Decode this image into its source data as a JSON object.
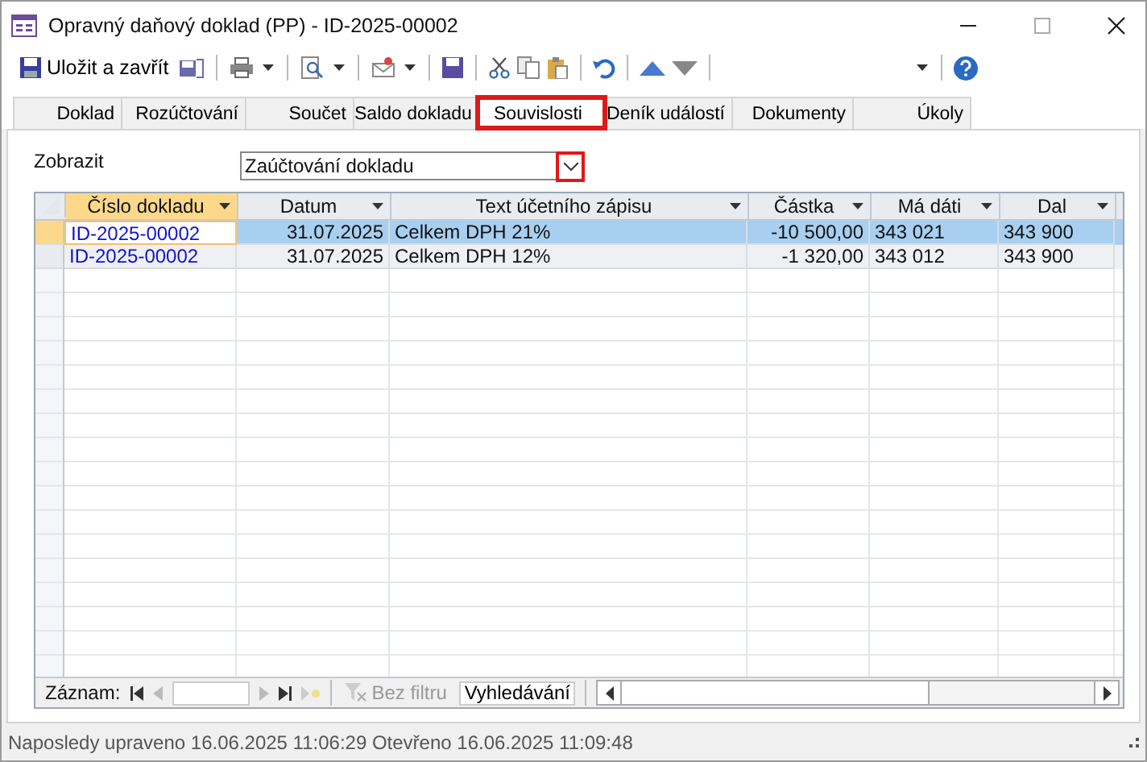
{
  "window": {
    "title": "Opravný daňový doklad (PP) - ID-2025-00002"
  },
  "toolbar": {
    "save_close": "Uložit a zavřít"
  },
  "tabs": [
    {
      "label": "Doklad",
      "selected": false,
      "highlighted": false
    },
    {
      "label": "Rozúčtování",
      "selected": false,
      "highlighted": false
    },
    {
      "label": "Součet",
      "selected": false,
      "highlighted": false
    },
    {
      "label": "Saldo dokladu",
      "selected": false,
      "highlighted": false
    },
    {
      "label": "Souvislosti",
      "selected": true,
      "highlighted": true
    },
    {
      "label": "Deník událostí",
      "selected": false,
      "highlighted": false
    },
    {
      "label": "Dokumenty",
      "selected": false,
      "highlighted": false
    },
    {
      "label": "Úkoly",
      "selected": false,
      "highlighted": false
    }
  ],
  "filter": {
    "label": "Zobrazit",
    "value": "Zaúčtování dokladu",
    "button_highlighted": true
  },
  "table": {
    "columns": [
      {
        "label": "Číslo dokladu",
        "selected": true
      },
      {
        "label": "Datum",
        "selected": false
      },
      {
        "label": "Text účetního zápisu",
        "selected": false
      },
      {
        "label": "Částka",
        "selected": false
      },
      {
        "label": "Má dáti",
        "selected": false
      },
      {
        "label": "Dal",
        "selected": false
      }
    ],
    "rows": [
      {
        "selected": true,
        "cells": [
          "ID-2025-00002",
          "31.07.2025",
          "Celkem DPH 21%",
          "-10 500,00",
          "343 021",
          "343 900"
        ]
      },
      {
        "selected": false,
        "cells": [
          "ID-2025-00002",
          "31.07.2025",
          "Celkem DPH 12%",
          "-1 320,00",
          "343 012",
          "343 900"
        ]
      }
    ]
  },
  "navigator": {
    "label": "Záznam:",
    "filter": "Bez filtru",
    "search": "Vyhledávání"
  },
  "status_bar": "Naposledy upraveno 16.06.2025 11:06:29 Otevřeno 16.06.2025 11:09:48"
}
